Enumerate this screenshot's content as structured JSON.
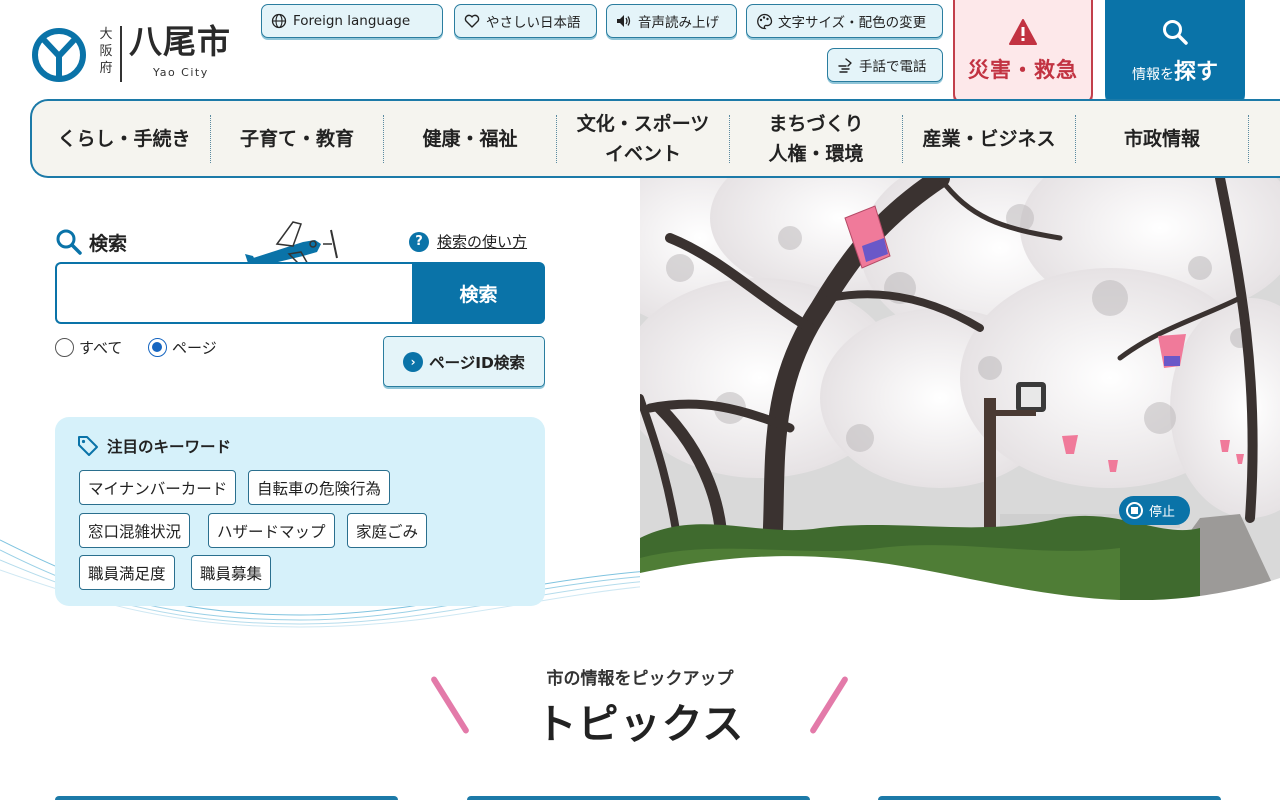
{
  "header": {
    "logo": {
      "prefecture": "大阪府",
      "name": "八尾市",
      "sub": "Yao City"
    },
    "utility": [
      {
        "label": "Foreign language",
        "icon": "globe-icon"
      },
      {
        "label": "やさしい日本語",
        "icon": "heart-icon"
      },
      {
        "label": "音声読み上げ",
        "icon": "speaker-icon"
      },
      {
        "label": "文字サイズ・配色の変更",
        "icon": "palette-icon"
      },
      {
        "label": "手話で電話",
        "icon": "sign-language-icon"
      }
    ],
    "emergency": {
      "label": "災害・救急",
      "icon": "warning-icon"
    },
    "find": {
      "small": "情報を",
      "big": "探す",
      "icon": "search-icon"
    }
  },
  "nav": [
    {
      "label": "くらし・手続き"
    },
    {
      "label": "子育て・教育"
    },
    {
      "label": "健康・福祉"
    },
    {
      "label": "文化・スポーツ\nイベント"
    },
    {
      "label": "まちづくり\n人権・環境"
    },
    {
      "label": "産業・ビジネス"
    },
    {
      "label": "市政情報"
    }
  ],
  "search": {
    "title": "検索",
    "help": "検索の使い方",
    "input_value": "",
    "button": "検索",
    "scope": [
      {
        "label": "すべて",
        "checked": false
      },
      {
        "label": "ページ",
        "checked": true
      }
    ],
    "page_id_button": "ページID検索"
  },
  "keywords": {
    "title": "注目のキーワード",
    "items": [
      "マイナンバーカード",
      "自転車の危険行為",
      "窓口混雑状況",
      "ハザードマップ",
      "家庭ごみ",
      "職員満足度",
      "職員募集"
    ]
  },
  "hero": {
    "stop_label": "停止"
  },
  "topics": {
    "subtitle": "市の情報をピックアップ",
    "title": "トピックス"
  },
  "colors": {
    "primary": "#0a73a8",
    "emergency": "#c23342",
    "accent_pink": "#e37aa9",
    "keyword_bg": "#d6f1fa"
  }
}
